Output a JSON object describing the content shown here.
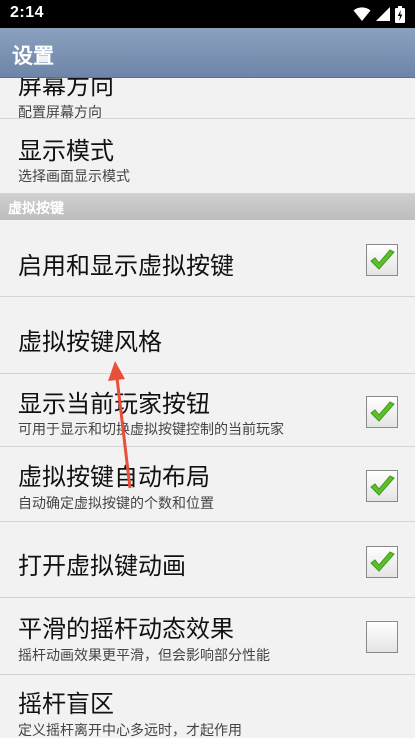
{
  "status_bar": {
    "time": "2:14",
    "icons": [
      "wifi-icon",
      "signal-icon",
      "battery-icon"
    ]
  },
  "app_bar": {
    "title": "设置"
  },
  "settings": {
    "screen_orientation": {
      "title": "屏幕方向",
      "summary": "配置屏幕方向"
    },
    "display_mode": {
      "title": "显示模式",
      "summary": "选择画面显示模式"
    },
    "section_virtual_keys": {
      "label": "虚拟按键"
    },
    "enable_virtual_keys": {
      "title": "启用和显示虚拟按键",
      "checked": true
    },
    "virtual_key_style": {
      "title": "虚拟按键风格"
    },
    "show_current_player": {
      "title": "显示当前玩家按钮",
      "summary": "可用于显示和切换虚拟按键控制的当前玩家",
      "checked": true
    },
    "auto_layout": {
      "title": "虚拟按键自动布局",
      "summary": "自动确定虚拟按键的个数和位置",
      "checked": true
    },
    "key_animation": {
      "title": "打开虚拟键动画",
      "checked": true
    },
    "smooth_joystick": {
      "title": "平滑的摇杆动态效果",
      "summary": "摇杆动画效果更平滑，但会影响部分性能",
      "checked": false
    },
    "joystick_deadzone": {
      "title": "摇杆盲区",
      "summary": "定义摇杆离开中心多远时，才起作用"
    }
  },
  "colors": {
    "app_bar": "#7a90b0",
    "check": "#5fbf2a",
    "annotation_arrow": "#e8503a"
  }
}
